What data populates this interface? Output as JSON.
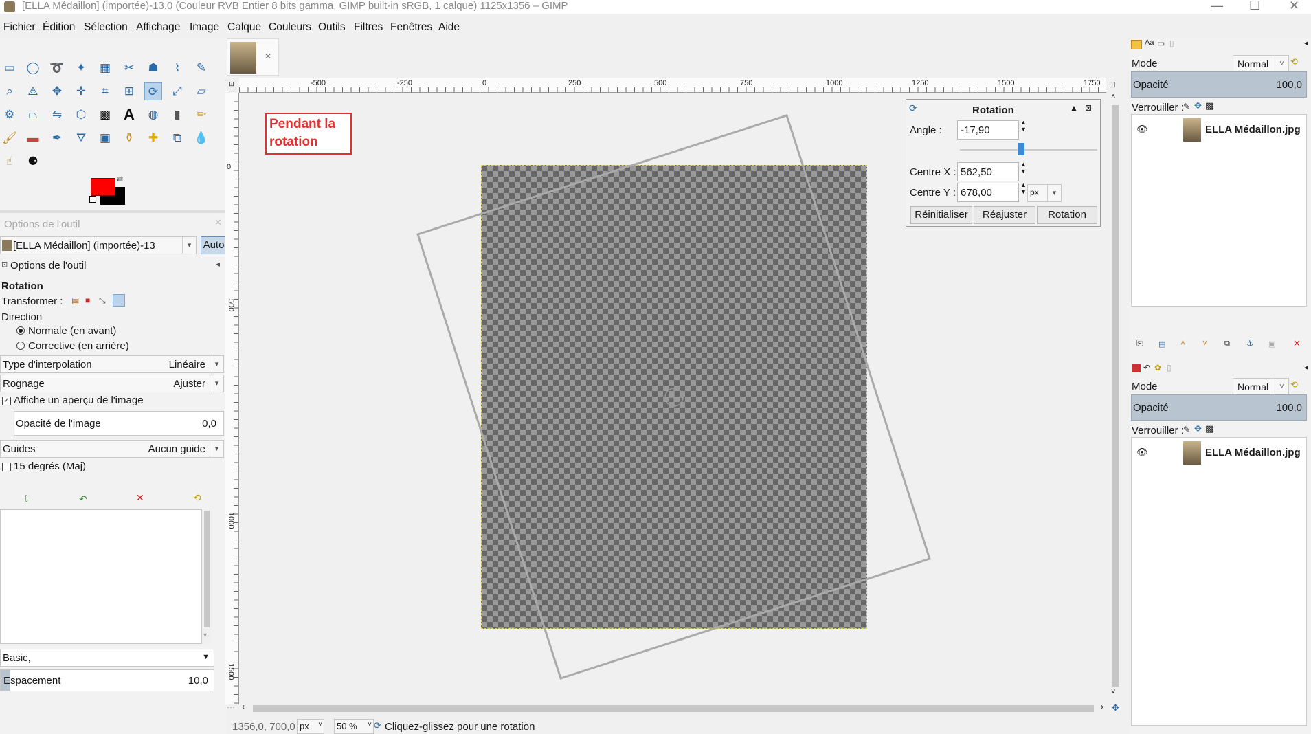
{
  "window": {
    "title": "[ELLA Médaillon] (importée)-13.0 (Couleur RVB Entier 8 bits gamma, GIMP built-in sRGB, 1 calque) 1125x1356 – GIMP",
    "controls": [
      "—",
      "☐",
      "✕"
    ]
  },
  "menu": [
    "Fichier",
    "Édition",
    "Sélection",
    "Affichage",
    "Image",
    "Calque",
    "Couleurs",
    "Outils",
    "Filtres",
    "Fenêtres",
    "Aide"
  ],
  "tool_options": {
    "panel_title": "Options de l'outil",
    "image_selector": "[ELLA Médaillon] (importée)-13",
    "auto_button": "Auto",
    "tab_label": "Options de l'outil",
    "tool_name": "Rotation",
    "transform_label": "Transformer :",
    "direction_label": "Direction",
    "direction_normal": "Normale (en avant)",
    "direction_corrective": "Corrective (en arrière)",
    "interpolation_label": "Type d'interpolation",
    "interpolation_value": "Linéaire",
    "clipping_label": "Rognage",
    "clipping_value": "Ajuster",
    "preview_label": "Affiche un aperçu de l'image",
    "preview_opacity_label": "Opacité de l'image",
    "preview_opacity_value": "0,0",
    "guides_label": "Guides",
    "guides_value": "Aucun guide",
    "constrain_label": "15 degrés (Maj)",
    "brush_value": "Basic,",
    "spacing_label": "Espacement",
    "spacing_value": "10,0"
  },
  "annotation": {
    "line1": "Pendant la",
    "line2": "rotation"
  },
  "ruler": {
    "h_labels": [
      "-500",
      "-250",
      "0",
      "250",
      "500",
      "750",
      "1000",
      "1250",
      "1500",
      "1750"
    ],
    "v_labels": [
      "0",
      "500",
      "1000",
      "1500"
    ]
  },
  "rotation_dialog": {
    "title": "Rotation",
    "angle_label": "Angle :",
    "angle_value": "-17,90",
    "center_x_label": "Centre X :",
    "center_x_value": "562,50",
    "center_y_label": "Centre Y :",
    "center_y_value": "678,00",
    "unit": "px",
    "reset_button": "Réinitialiser",
    "readjust_button": "Réajuster",
    "rotate_button": "Rotation",
    "angle_degrees": -17.9
  },
  "layers_panel_1": {
    "mode_label": "Mode",
    "mode_value": "Normal",
    "opacity_label": "Opacité",
    "opacity_value": "100,0",
    "lock_label": "Verrouiller :",
    "layer_name": "ELLA Médaillon.jpg"
  },
  "layers_panel_2": {
    "mode_label": "Mode",
    "mode_value": "Normal",
    "opacity_label": "Opacité",
    "opacity_value": "100,0",
    "lock_label": "Verrouiller :",
    "layer_name": "ELLA Médaillon.jpg"
  },
  "status": {
    "coords": "1356,0, 700,0",
    "unit": "px",
    "zoom": "50 %",
    "message": "Cliquez-glissez pour une rotation"
  },
  "colors": {
    "foreground": "#ff0000",
    "background": "#000000",
    "accent": "#2a6aa8",
    "annotation": "#e03030"
  }
}
